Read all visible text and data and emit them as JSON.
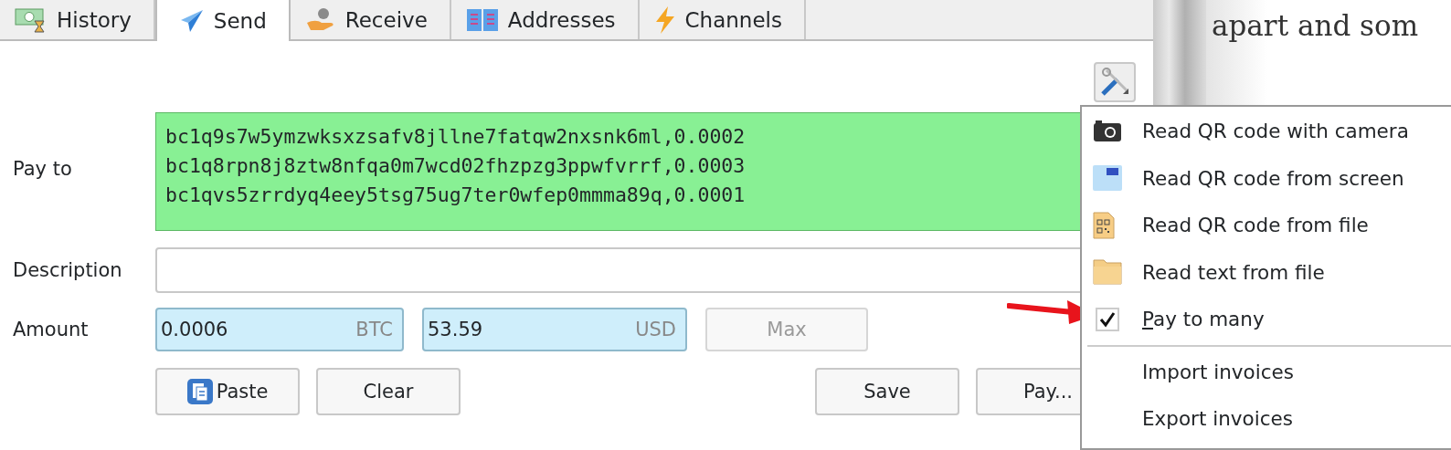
{
  "tabs": [
    {
      "label": "History",
      "selected": false
    },
    {
      "label": "Send",
      "selected": true
    },
    {
      "label": "Receive",
      "selected": false
    },
    {
      "label": "Addresses",
      "selected": false
    },
    {
      "label": "Channels",
      "selected": false
    }
  ],
  "form": {
    "pay_to": {
      "label": "Pay to",
      "valid": true,
      "lines": [
        "bc1q9s7w5ymzwksxzsafv8jllne7fatqw2nxsnk6ml,0.0002",
        "bc1q8rpn8j8ztw8nfqa0m7wcd02fhzpzg3ppwfvrrf,0.0003",
        "bc1qvs5zrrdyq4eey5tsg75ug7ter0wfep0mmma89q,0.0001"
      ]
    },
    "description": {
      "label": "Description"
    },
    "amount": {
      "label": "Amount",
      "btc": {
        "value": "0.0006",
        "unit": "BTC"
      },
      "fiat": {
        "value": "53.59",
        "unit": "USD"
      },
      "max_button": {
        "label": "Max",
        "disabled": true
      }
    },
    "buttons": [
      {
        "label": "Paste",
        "kind": "paste"
      },
      {
        "label": "Clear",
        "kind": "plain"
      },
      {
        "label": "Save",
        "kind": "plain"
      },
      {
        "label": "Pay...",
        "kind": "plain"
      }
    ]
  },
  "menu": {
    "groups": [
      [
        {
          "label": "Read QR code with camera",
          "kind": "camera"
        },
        {
          "label": "Read QR code from screen",
          "kind": "screen"
        },
        {
          "label": "Read QR code from file",
          "kind": "qr-file"
        },
        {
          "label": "Read text from file",
          "kind": "folder"
        },
        {
          "label": "Pay to many",
          "kind": "checkbox",
          "checked": true
        }
      ],
      [
        {
          "label": "Import invoices",
          "kind": "plain"
        },
        {
          "label": "Export invoices",
          "kind": "plain"
        }
      ]
    ]
  },
  "document_text": "apart and som"
}
